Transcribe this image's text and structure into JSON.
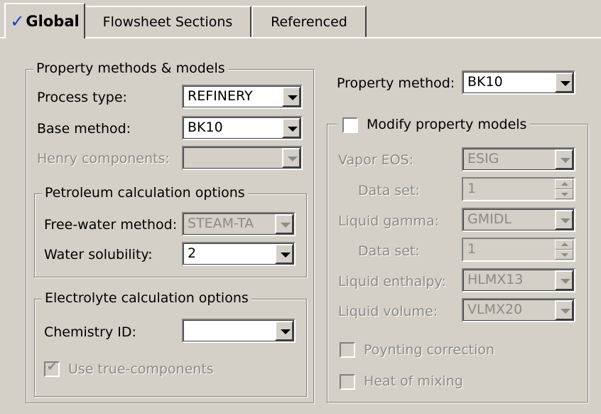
{
  "tabs": [
    {
      "label": "Global",
      "check": "✓"
    },
    {
      "label": "Flowsheet Sections"
    },
    {
      "label": "Referenced"
    }
  ],
  "property_methods_group": {
    "title": "Property methods & models",
    "process_type_label": "Process type:",
    "process_type_value": "REFINERY",
    "base_method_label": "Base method:",
    "base_method_value": "BK10",
    "henry_components_label": "Henry components:",
    "henry_components_value": ""
  },
  "petroleum_group": {
    "title": "Petroleum calculation options",
    "free_water_label": "Free-water method:",
    "free_water_value": "STEAM-TA",
    "water_solubility_label": "Water solubility:",
    "water_solubility_value": "2"
  },
  "electrolyte_group": {
    "title": "Electrolyte calculation options",
    "chemistry_id_label": "Chemistry ID:",
    "chemistry_id_value": "",
    "use_true_components_label": "Use true-components",
    "use_true_components_checked": true
  },
  "right": {
    "property_method_label": "Property method:",
    "property_method_value": "BK10",
    "modify_models_label": "Modify property models",
    "modify_models_checked": false,
    "vapor_eos_label": "Vapor EOS:",
    "vapor_eos_value": "ESIG",
    "vapor_data_set_label": "Data set:",
    "vapor_data_set_value": "1",
    "liquid_gamma_label": "Liquid gamma:",
    "liquid_gamma_value": "GMIDL",
    "gamma_data_set_label": "Data set:",
    "gamma_data_set_value": "1",
    "liquid_enthalpy_label": "Liquid enthalpy:",
    "liquid_enthalpy_value": "HLMX13",
    "liquid_volume_label": "Liquid volume:",
    "liquid_volume_value": "VLMX20",
    "poynting_label": "Poynting correction",
    "heat_of_mixing_label": "Heat of mixing"
  }
}
